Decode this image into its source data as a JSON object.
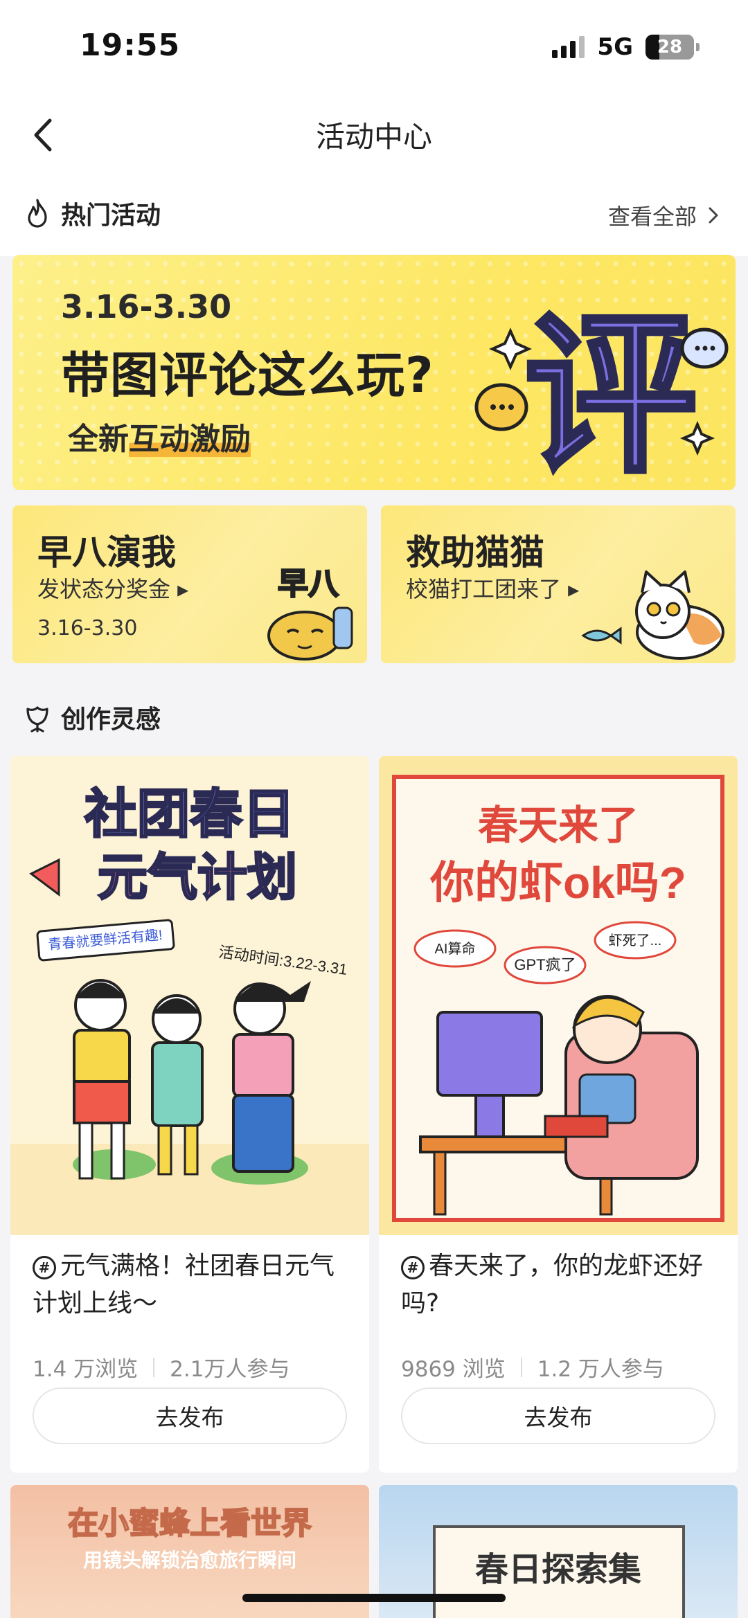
{
  "status_bar": {
    "time": "19:55",
    "network": "5G",
    "battery": "28",
    "battery_level": 0.28
  },
  "nav": {
    "title": "活动中心",
    "back_icon": "chevron-left-icon"
  },
  "hot_section": {
    "title": "热门活动",
    "icon": "flame-icon",
    "see_all": "查看全部"
  },
  "hero_banner": {
    "date": "3.16-3.30",
    "title": "带图评论这么玩?",
    "subtitle_prefix": "全新",
    "subtitle_highlight": "互动激励",
    "badge_char": "评"
  },
  "small_cards": [
    {
      "title": "早八演我",
      "subtitle": "发状态分奖金 ▸",
      "date": "3.16-3.30",
      "art_text": "早八"
    },
    {
      "title": "救助猫猫",
      "subtitle": "校猫打工团来了 ▸"
    }
  ],
  "inspiration_section": {
    "title": "创作灵感",
    "icon": "flower-icon"
  },
  "posts": [
    {
      "poster_line1": "社团春日",
      "poster_line2": "元气计划",
      "poster_tag": "青春就要鲜活有趣!",
      "poster_time": "活动时间:3.22-3.31",
      "title": "元气满格！社团春日元气计划上线～",
      "views": "1.4 万浏览",
      "participants": "2.1万人参与",
      "button": "去发布"
    },
    {
      "poster_line1": "春天来了",
      "poster_line2": "你的虾ok吗?",
      "bubbles": [
        "AI算命",
        "GPT疯了",
        "虾死了..."
      ],
      "title": "春天来了，你的龙虾还好吗?",
      "views": "9869 浏览",
      "participants": "1.2 万人参与",
      "button": "去发布"
    }
  ],
  "bottom_cards": [
    {
      "title": "在小蜜蜂上看世界",
      "subtitle": "用镜头解锁治愈旅行瞬间"
    },
    {
      "title": "春日探索集"
    }
  ],
  "colors": {
    "banner_yellow": "#fde763",
    "accent_orange": "#f5b536",
    "badge_purple": "#7b6fe0"
  }
}
